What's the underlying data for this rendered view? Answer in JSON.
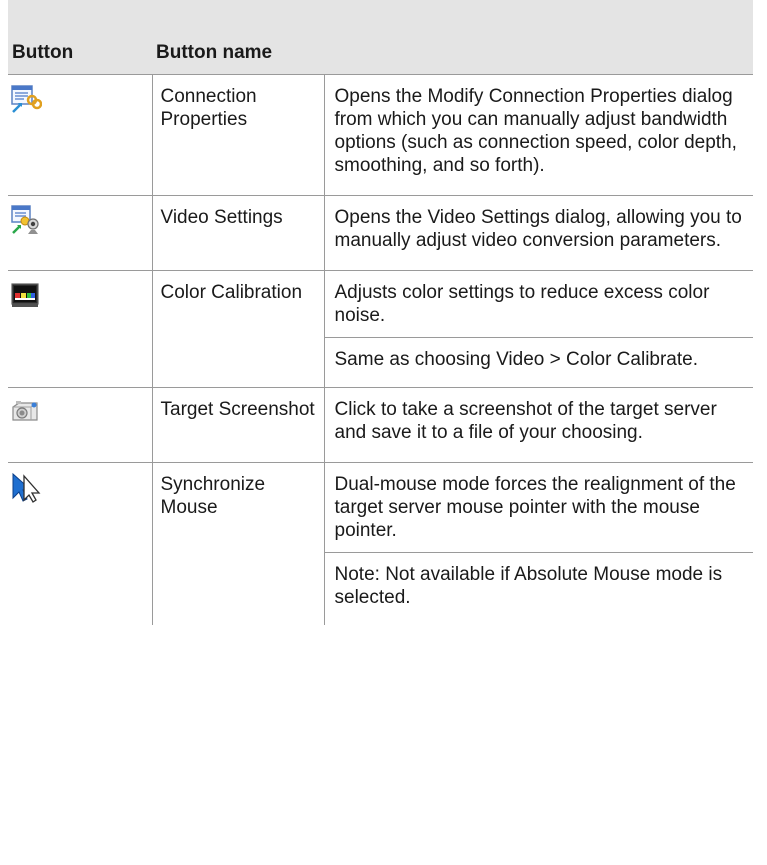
{
  "table": {
    "headers": [
      "Button",
      "Button name",
      ""
    ],
    "rows": [
      {
        "icon": "connection-properties-icon",
        "name": "Connection Properties",
        "desc": [
          "Opens the Modify Connection Properties dialog from which you can manually adjust bandwidth options (such as connection speed, color depth, smoothing, and so forth)."
        ]
      },
      {
        "icon": "video-settings-icon",
        "name": "Video Settings",
        "desc": [
          "Opens the Video Settings dialog, allowing you to manually adjust video conversion parameters."
        ]
      },
      {
        "icon": "color-calibration-icon",
        "name": "Color Calibration",
        "desc": [
          "Adjusts color settings to reduce excess color noise.",
          "Same as choosing Video > Color Calibrate."
        ]
      },
      {
        "icon": "camera-icon",
        "name": "Target Screenshot",
        "desc": [
          "Click to take a screenshot of the target server and save it to a file of your choosing."
        ]
      },
      {
        "icon": "mouse-pointer-icon",
        "name": "Synchronize Mouse",
        "desc": [
          "Dual-mouse mode forces the realignment of the target server mouse pointer with the mouse pointer.",
          "Note: Not available if Absolute Mouse mode is selected."
        ]
      }
    ]
  },
  "colors": {
    "header_bg": "#e4e4e4",
    "rule": "#9a9a9a"
  }
}
